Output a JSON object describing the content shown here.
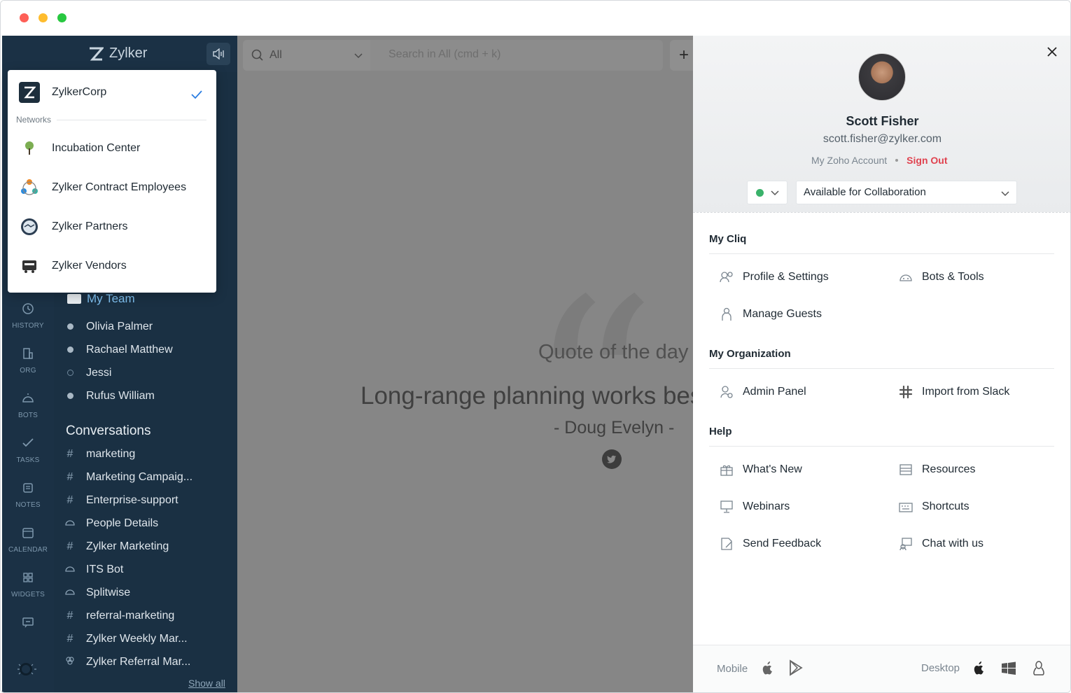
{
  "app": {
    "brand": "Zylker"
  },
  "rail": [
    {
      "icon": "history-icon",
      "label": "HISTORY"
    },
    {
      "icon": "org-icon",
      "label": "ORG"
    },
    {
      "icon": "bots-icon",
      "label": "BOTS"
    },
    {
      "icon": "tasks-icon",
      "label": "TASKS"
    },
    {
      "icon": "notes-icon",
      "label": "NOTES"
    },
    {
      "icon": "calendar-icon",
      "label": "CALENDAR"
    },
    {
      "icon": "widgets-icon",
      "label": "WIDGETS"
    }
  ],
  "networks": {
    "current": "ZylkerCorp",
    "section_label": "Networks",
    "items": [
      "Incubation Center",
      "Zylker Contract Employees",
      "Zylker Partners",
      "Zylker Vendors"
    ]
  },
  "sidebar": {
    "team_label": "My Team",
    "team_members": [
      "Olivia Palmer",
      "Rachael Matthew",
      "Jessi",
      "Rufus William"
    ],
    "conversations_heading": "Conversations",
    "conversations": [
      {
        "glyph": "#",
        "name": "marketing"
      },
      {
        "glyph": "#",
        "name": "Marketing Campaig..."
      },
      {
        "glyph": "#",
        "name": "Enterprise-support"
      },
      {
        "glyph": "bot",
        "name": "People Details"
      },
      {
        "glyph": "#",
        "name": "Zylker Marketing"
      },
      {
        "glyph": "bot",
        "name": "ITS Bot"
      },
      {
        "glyph": "bot",
        "name": "Splitwise"
      },
      {
        "glyph": "#",
        "name": "referral-marketing"
      },
      {
        "glyph": "#",
        "name": "Zylker Weekly Mar..."
      },
      {
        "glyph": "group",
        "name": "Zylker Referral Mar..."
      }
    ],
    "show_all": "Show all"
  },
  "search": {
    "scope": "All",
    "placeholder": "Search in All (cmd + k)"
  },
  "quote": {
    "title": "Quote of the day",
    "text": "Long-range planning works best in the short term",
    "author": "- Doug Evelyn -"
  },
  "profile": {
    "name": "Scott Fisher",
    "email": "scott.fisher@zylker.com",
    "account_link": "My Zoho Account",
    "sign_out": "Sign Out",
    "status_color": "#3ab26a",
    "status_message": "Available for Collaboration"
  },
  "menu": {
    "my_cliq": {
      "title": "My Cliq",
      "items": [
        "Profile & Settings",
        "Bots & Tools",
        "Manage Guests"
      ]
    },
    "my_org": {
      "title": "My Organization",
      "items": [
        "Admin Panel",
        "Import from Slack"
      ]
    },
    "help": {
      "title": "Help",
      "items": [
        "What's New",
        "Resources",
        "Webinars",
        "Shortcuts",
        "Send Feedback",
        "Chat with us"
      ]
    }
  },
  "footer": {
    "mobile_label": "Mobile",
    "desktop_label": "Desktop"
  }
}
